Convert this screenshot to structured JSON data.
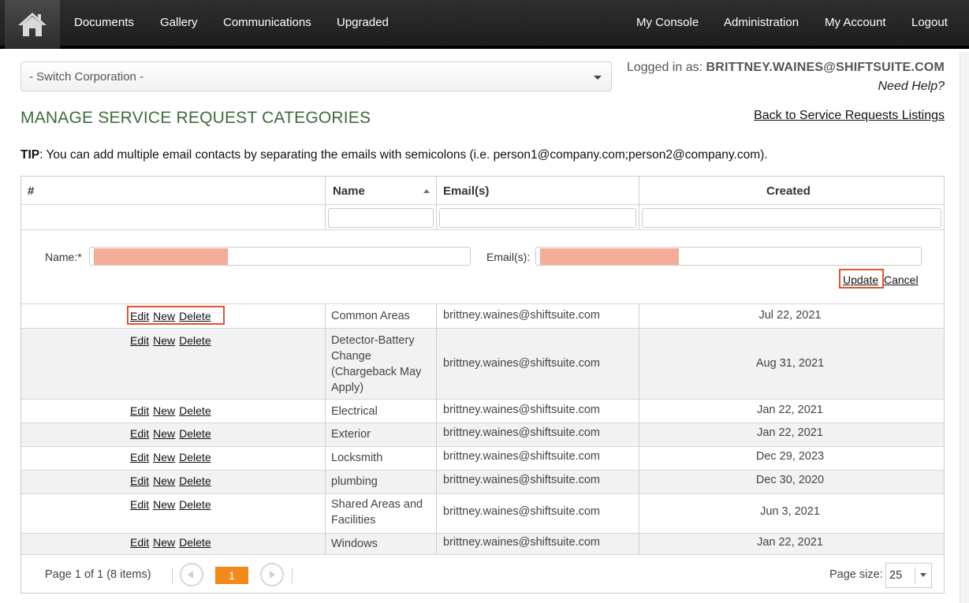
{
  "nav": {
    "home_icon": "house-icon",
    "left_items": [
      "Documents",
      "Gallery",
      "Communications",
      "Upgraded"
    ],
    "right_items": [
      "My Console",
      "Administration",
      "My Account",
      "Logout"
    ]
  },
  "header": {
    "switch_corp": "- Switch Corporation -",
    "logged_in_label": "Logged in as:",
    "logged_in_user": "BRITTNEY.WAINES@SHIFTSUITE.COM",
    "need_help": "Need Help?",
    "page_title": "MANAGE SERVICE REQUEST CATEGORIES",
    "back_link": "Back to Service Requests Listings",
    "tip_label": "TIP",
    "tip_text": ": You can add multiple email contacts by separating the emails with semicolons (i.e. person1@company.com;person2@company.com)."
  },
  "grid": {
    "columns": [
      "#",
      "Name",
      "Email(s)",
      "Created"
    ],
    "sort_column": "Name",
    "sort_direction": "ascending",
    "edit_form": {
      "name_label": "Name:*",
      "email_label": "Email(s):",
      "update": "Update",
      "cancel": "Cancel"
    },
    "row_actions": [
      "Edit",
      "New",
      "Delete"
    ],
    "rows": [
      {
        "name": "Common Areas",
        "email": "brittney.waines@shiftsuite.com",
        "created": "Jul 22, 2021"
      },
      {
        "name": "Detector-Battery Change (Chargeback May Apply)",
        "email": "brittney.waines@shiftsuite.com",
        "created": "Aug 31, 2021"
      },
      {
        "name": "Electrical",
        "email": "brittney.waines@shiftsuite.com",
        "created": "Jan 22, 2021"
      },
      {
        "name": "Exterior",
        "email": "brittney.waines@shiftsuite.com",
        "created": "Jan 22, 2021"
      },
      {
        "name": "Locksmith",
        "email": "brittney.waines@shiftsuite.com",
        "created": "Dec 29, 2023"
      },
      {
        "name": "plumbing",
        "email": "brittney.waines@shiftsuite.com",
        "created": "Dec 30, 2020"
      },
      {
        "name": "Shared Areas and Facilities",
        "email": "brittney.waines@shiftsuite.com",
        "created": "Jun 3, 2021"
      },
      {
        "name": "Windows",
        "email": "brittney.waines@shiftsuite.com",
        "created": "Jan 22, 2021"
      }
    ],
    "pager": {
      "info": "Page 1 of 1 (8 items)",
      "current_page": "1",
      "page_size_label": "Page size:",
      "page_size": "25"
    }
  },
  "colors": {
    "nav_bg": "#262626",
    "title_green": "#3d6b3d",
    "highlight": "#e0552a",
    "pager_active": "#f18a1a",
    "redaction": "#f5ad9a"
  }
}
